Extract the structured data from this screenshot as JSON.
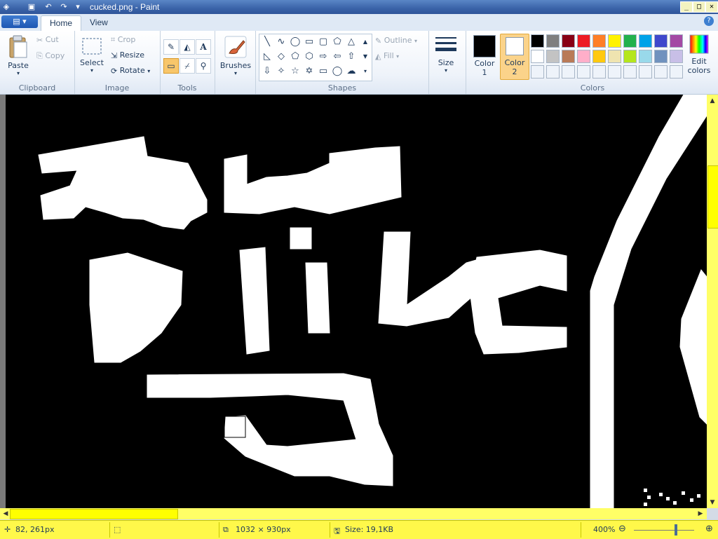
{
  "window": {
    "title": "cucked.png - Paint",
    "controls": {
      "minimize": "_",
      "maximize": "□",
      "close": "✕"
    }
  },
  "ribbon": {
    "tabs": [
      {
        "label": "Home"
      },
      {
        "label": "View"
      }
    ],
    "clipboard": {
      "paste": "Paste",
      "cut": "Cut",
      "copy": "Copy",
      "group": "Clipboard"
    },
    "image": {
      "select": "Select",
      "crop": "Crop",
      "resize": "Resize",
      "rotate": "Rotate",
      "group": "Image"
    },
    "tools": {
      "group": "Tools"
    },
    "brushes": {
      "label": "Brushes"
    },
    "shapes": {
      "outline": "Outline",
      "fill": "Fill",
      "group": "Shapes"
    },
    "size": {
      "label": "Size"
    },
    "colors": {
      "color1_label": "Color",
      "color1_num": "1",
      "color2_label": "Color",
      "color2_num": "2",
      "edit_label": "Edit",
      "edit_label2": "colors",
      "group": "Colors",
      "color1_value": "#000000",
      "color2_value": "#ffffff",
      "palette_row1": [
        "#000000",
        "#7f7f7f",
        "#880015",
        "#ed1c24",
        "#ff7f27",
        "#fff200",
        "#22b14c",
        "#00a2e8",
        "#3f48cc",
        "#a349a4"
      ],
      "palette_row2": [
        "#ffffff",
        "#c3c3c3",
        "#b97a57",
        "#ffaec9",
        "#ffc90e",
        "#efe4b0",
        "#b5e61d",
        "#99d9ea",
        "#7092be",
        "#c8bfe7"
      ]
    }
  },
  "status": {
    "cursor_pos": "82, 261px",
    "image_size": "1032 × 930px",
    "file_size": "Size: 19,1KB",
    "zoom": "400%"
  }
}
